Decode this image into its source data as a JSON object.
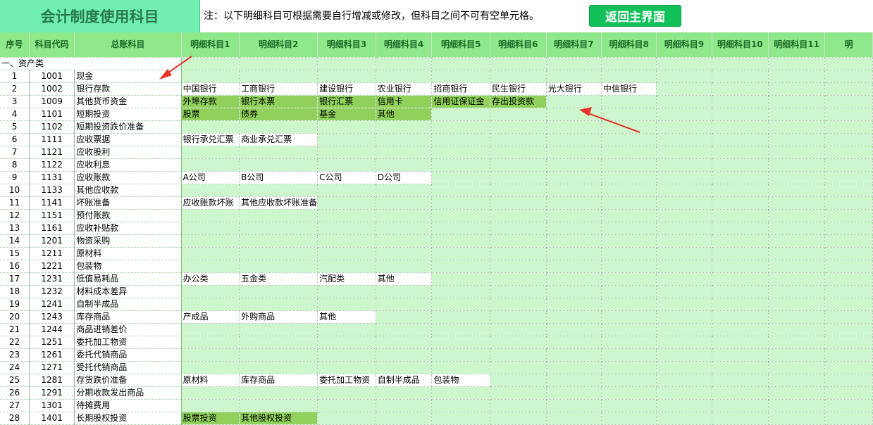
{
  "header": {
    "title": "会计制度使用科目",
    "note": "注：以下明细科目可根据需要自行增减或修改，但科目之间不可有空单元格。",
    "back_button": "返回主界面"
  },
  "columns": {
    "seq": "序号",
    "code": "科目代码",
    "account": "总账科目",
    "details": [
      "明细科目1",
      "明细科目2",
      "明细科目3",
      "明细科目4",
      "明细科目5",
      "明细科目6",
      "明细科目7",
      "明细科目8",
      "明细科目9",
      "明细科目10",
      "明细科目11",
      "明"
    ]
  },
  "category": "一、资产类",
  "rows": [
    {
      "seq": "1",
      "code": "1001",
      "name": "现金",
      "details": []
    },
    {
      "seq": "2",
      "code": "1002",
      "name": "银行存款",
      "details": [
        "中国银行",
        "工商银行",
        "建设银行",
        "农业银行",
        "招商银行",
        "民生银行",
        "光大银行",
        "中信银行"
      ]
    },
    {
      "seq": "3",
      "code": "1009",
      "name": "其他货币资金",
      "details": [
        "外埠存款",
        "银行本票",
        "银行汇票",
        "信用卡",
        "信用证保证金",
        "存出投资款"
      ]
    },
    {
      "seq": "4",
      "code": "1101",
      "name": "短期投资",
      "details": [
        "股票",
        "债券",
        "基金",
        "其他"
      ]
    },
    {
      "seq": "5",
      "code": "1102",
      "name": "短期投资跌价准备",
      "details": []
    },
    {
      "seq": "6",
      "code": "1111",
      "name": "应收票据",
      "details": [
        "银行承兑汇票",
        "商业承兑汇票"
      ]
    },
    {
      "seq": "7",
      "code": "1121",
      "name": "应收股利",
      "details": []
    },
    {
      "seq": "8",
      "code": "1122",
      "name": "应收利息",
      "details": []
    },
    {
      "seq": "9",
      "code": "1131",
      "name": "应收账款",
      "details": [
        "A公司",
        "B公司",
        "C公司",
        "D公司"
      ]
    },
    {
      "seq": "10",
      "code": "1133",
      "name": "其他应收款",
      "details": []
    },
    {
      "seq": "11",
      "code": "1141",
      "name": "坏账准备",
      "details": [
        "应收账款坏账",
        "其他应收款坏账准备"
      ]
    },
    {
      "seq": "12",
      "code": "1151",
      "name": "预付账款",
      "details": []
    },
    {
      "seq": "13",
      "code": "1161",
      "name": "应收补贴款",
      "details": []
    },
    {
      "seq": "14",
      "code": "1201",
      "name": "物资采购",
      "details": []
    },
    {
      "seq": "15",
      "code": "1211",
      "name": "原材料",
      "details": []
    },
    {
      "seq": "16",
      "code": "1221",
      "name": "包装物",
      "details": []
    },
    {
      "seq": "17",
      "code": "1231",
      "name": "低值易耗品",
      "details": [
        "办公类",
        "五金类",
        "汽配类",
        "其他"
      ]
    },
    {
      "seq": "18",
      "code": "1232",
      "name": "材料成本差异",
      "details": []
    },
    {
      "seq": "19",
      "code": "1241",
      "name": "自制半成品",
      "details": []
    },
    {
      "seq": "20",
      "code": "1243",
      "name": "库存商品",
      "details": [
        "产成品",
        "外购商品",
        "其他"
      ]
    },
    {
      "seq": "21",
      "code": "1244",
      "name": "商品进销差价",
      "details": []
    },
    {
      "seq": "22",
      "code": "1251",
      "name": "委托加工物资",
      "details": []
    },
    {
      "seq": "23",
      "code": "1261",
      "name": "委托代销商品",
      "details": []
    },
    {
      "seq": "24",
      "code": "1271",
      "name": "受托代销商品",
      "details": []
    },
    {
      "seq": "25",
      "code": "1281",
      "name": "存货跌价准备",
      "details": [
        "原材料",
        "库存商品",
        "委托加工物资",
        "自制半成品",
        "包装物"
      ]
    },
    {
      "seq": "26",
      "code": "1291",
      "name": "分期收款发出商品",
      "details": []
    },
    {
      "seq": "27",
      "code": "1301",
      "name": "待摊费用",
      "details": []
    },
    {
      "seq": "28",
      "code": "1401",
      "name": "长期股权投资",
      "details": [
        "股票投资",
        "其他股权投资"
      ]
    }
  ],
  "colors": {
    "title_bg": "#70f0b0",
    "button_bg": "#12c15a",
    "header_bg": "#94f094",
    "empty_cell": "#cdf6cd",
    "dark_green_cell": "#8fd15a",
    "arrow": "#e8332a"
  }
}
